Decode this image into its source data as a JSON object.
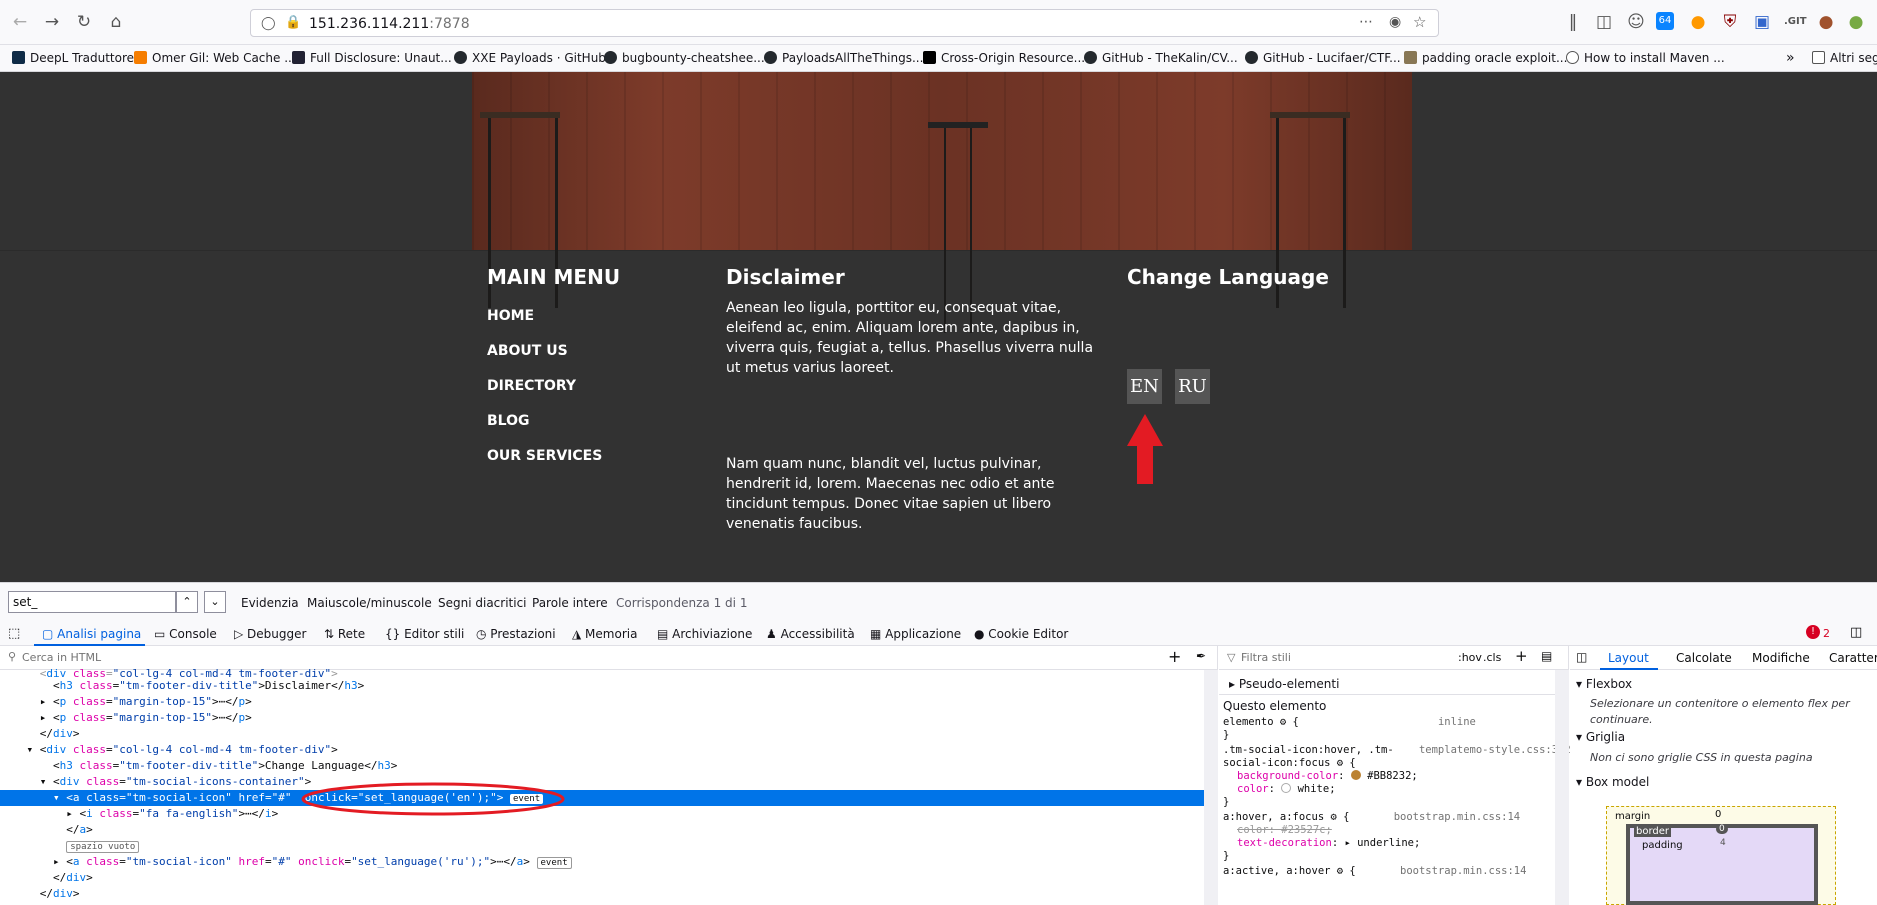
{
  "browser": {
    "url_host": "151.236.114.211",
    "url_port": ":7878",
    "bookmarks": [
      "DeepL Traduttore",
      "Omer Gil: Web Cache ...",
      "Full Disclosure: Unaut...",
      "XXE Payloads · GitHub",
      "bugbounty-cheatshee...",
      "PayloadsAllTheThings...",
      "Cross-Origin Resource...",
      "GitHub - TheKalin/CV...",
      "GitHub - Lucifaer/CTF...",
      "padding oracle exploit...",
      "How to install Maven ..."
    ],
    "other_bookmarks": "Altri segn"
  },
  "site": {
    "main_menu_title": "MAIN MENU",
    "menu_items": [
      "HOME",
      "ABOUT US",
      "DIRECTORY",
      "BLOG",
      "OUR SERVICES"
    ],
    "disclaimer_title": "Disclaimer",
    "disclaimer_p1": "Aenean leo ligula, porttitor eu, consequat vitae, eleifend ac, enim. Aliquam lorem ante, dapibus in, viverra quis, feugiat a, tellus. Phasellus viverra nulla ut metus varius laoreet.",
    "disclaimer_p2": "Nam quam nunc, blandit vel, luctus pulvinar, hendrerit id, lorem. Maecenas nec odio et ante tincidunt tempus. Donec vitae sapien ut libero venenatis faucibus.",
    "lang_title": "Change Language",
    "lang_en": "EN",
    "lang_ru": "RU",
    "arrow_color": "#e31b23"
  },
  "findbar": {
    "query": "set_",
    "opt_highlight": "Evidenzia",
    "opt_case": "Maiuscole/minuscole",
    "opt_diacritics": "Segni diacritici",
    "opt_whole": "Parole intere",
    "result": "Corrispondenza 1 di 1"
  },
  "devtools": {
    "tabs": [
      "Analisi pagina",
      "Console",
      "Debugger",
      "Rete",
      "Editor stili",
      "Prestazioni",
      "Memoria",
      "Archiviazione",
      "Accessibilità",
      "Applicazione",
      "Cookie Editor"
    ],
    "error_count": "2",
    "html_search_placeholder": "Cerca in HTML",
    "styles_filter_placeholder": "Filtra stili",
    "hov": ":hov",
    "cls": ".cls",
    "pseudo": "Pseudo-elementi",
    "this_element": "Questo elemento",
    "layout_tabs": [
      "Layout",
      "Calcolate",
      "Modifiche",
      "Caratteri"
    ],
    "flexbox": "Flexbox",
    "flexbox_msg": "Selezionare un contenitore o elemento flex per continuare.",
    "grid": "Griglia",
    "grid_msg": "Non ci sono griglie CSS in questa pagina",
    "boxmodel": "Box model",
    "bm_margin": "margin",
    "bm_border": "border",
    "bm_padding": "padding",
    "bm_zero": "0",
    "bm_four": "4",
    "spazio": "spazio vuoto",
    "event_badge": "event"
  }
}
